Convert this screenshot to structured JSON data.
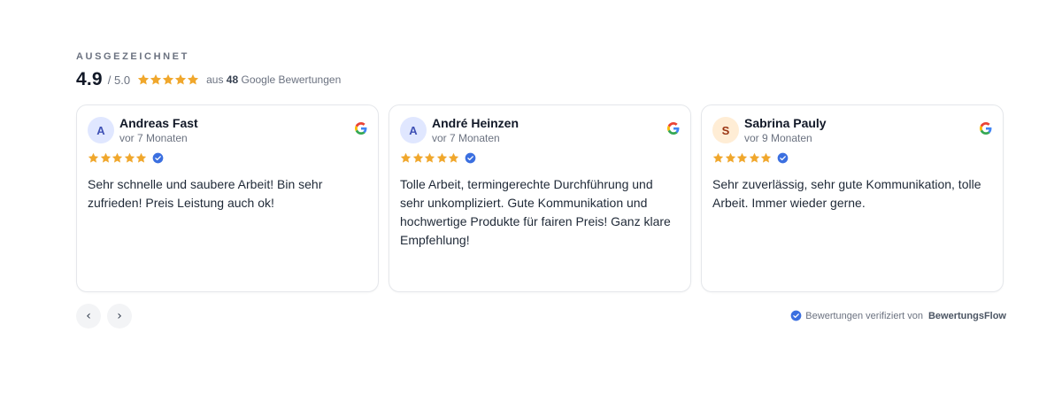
{
  "header": {
    "eyebrow": "AUSGEZEICHNET",
    "score": "4.9",
    "out_of": "/ 5.0",
    "count_prefix": "aus",
    "count": "48",
    "count_suffix": "Google Bewertungen"
  },
  "colors": {
    "star": "#f0a72c",
    "verified": "#3b6fe0",
    "avatar_blue_bg": "#e0e7ff",
    "avatar_blue_fg": "#3f51b5",
    "avatar_orange_bg": "#ffedd5",
    "avatar_orange_fg": "#9a3412"
  },
  "reviews": [
    {
      "initial": "A",
      "name": "Andreas Fast",
      "time": "vor 7 Monaten",
      "rating": 5,
      "source_icon": "google-icon",
      "text": "Sehr schnelle und saubere Arbeit! Bin sehr zufrieden! Preis Leistung auch ok!"
    },
    {
      "initial": "A",
      "name": "André Heinzen",
      "time": "vor 7 Monaten",
      "rating": 5,
      "source_icon": "google-icon",
      "text": "Tolle Arbeit, termingerechte Durchführung und sehr unkompliziert. Gute Kommunikation und hochwertige Produkte für fairen Preis! Ganz klare Empfehlung!"
    },
    {
      "initial": "S",
      "name": "Sabrina Pauly",
      "time": "vor 9 Monaten",
      "rating": 5,
      "source_icon": "google-icon",
      "text": "Sehr zuverlässig, sehr gute Kommunikation, tolle Arbeit. Immer wieder gerne."
    }
  ],
  "nav": {
    "prev_label": "‹",
    "next_label": "›"
  },
  "footer": {
    "verified_text": "Bewertungen verifiziert von",
    "brand": "BewertungsFlow"
  }
}
